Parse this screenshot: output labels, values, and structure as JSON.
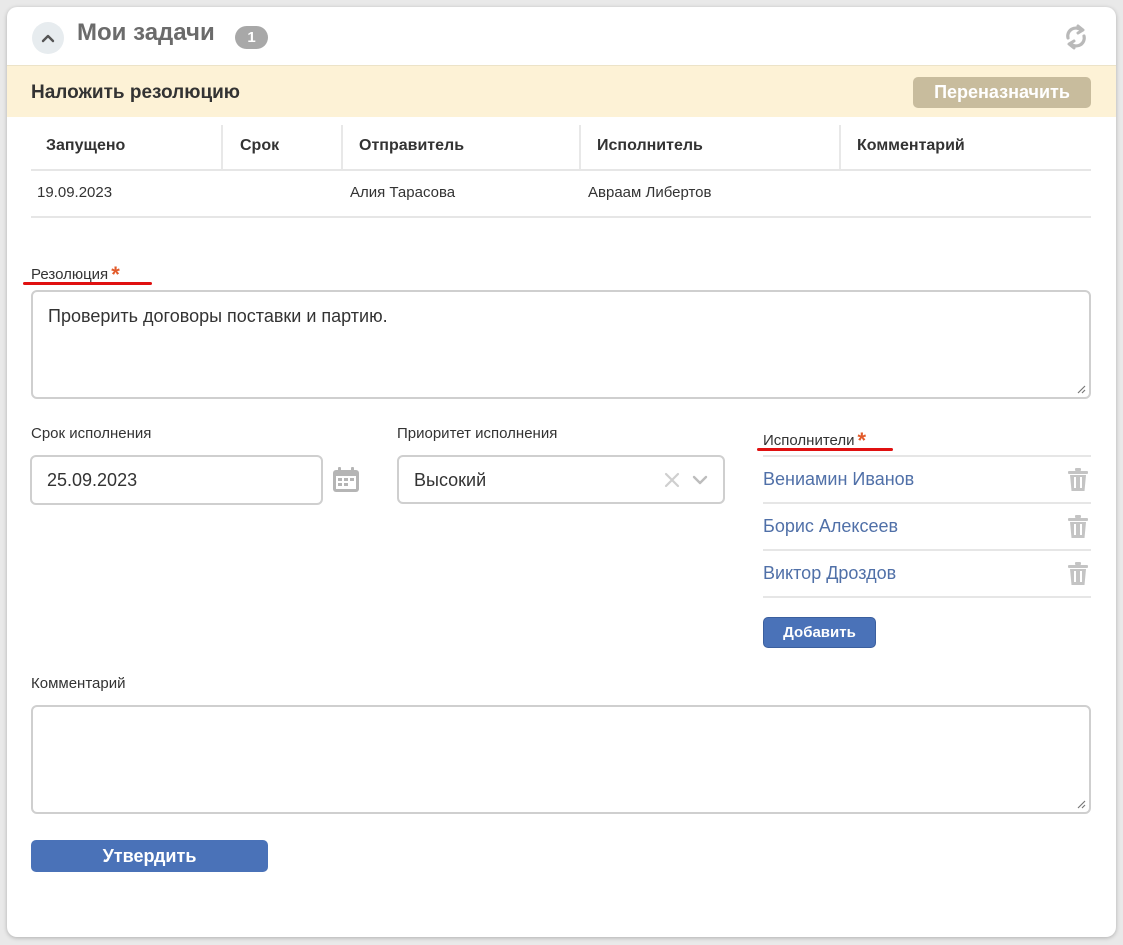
{
  "header": {
    "title": "Мои задачи",
    "count": "1"
  },
  "task": {
    "title": "Наложить резолюцию",
    "reassign_label": "Переназначить"
  },
  "table": {
    "columns": [
      "Запущено",
      "Срок",
      "Отправитель",
      "Исполнитель",
      "Комментарий"
    ],
    "rows": [
      [
        "19.09.2023",
        "",
        "Алия Тарасова",
        "Авраам Либертов",
        ""
      ]
    ]
  },
  "form": {
    "resolution_label": "Резолюция",
    "resolution_value": "Проверить договоры поставки и партию.",
    "required_mark": "*",
    "due_label": "Срок исполнения",
    "due_value": "25.09.2023",
    "priority_label": "Приоритет исполнения",
    "priority_value": "Высокий",
    "executors_label": "Исполнители",
    "executors": [
      "Вениамин Иванов",
      "Борис Алексеев",
      "Виктор Дроздов"
    ],
    "add_label": "Добавить",
    "comment_label": "Комментарий",
    "comment_value": "",
    "approve_label": "Утвердить"
  },
  "colors": {
    "accent": "#4a72b8",
    "task_bar": "#fdf2d6",
    "reassign": "#c8bc9d",
    "required": "#e25b2b",
    "link": "#5070a8",
    "highlight_underline": "#e01010"
  },
  "icons": [
    "chevron-up-icon",
    "refresh-icon",
    "calendar-icon",
    "clear-icon",
    "chevron-down-icon",
    "trash-icon",
    "resize-grip-icon"
  ]
}
